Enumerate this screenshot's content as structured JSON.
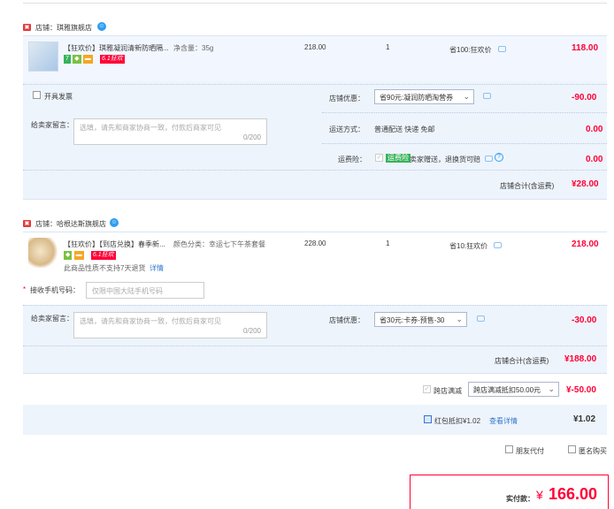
{
  "shop1": {
    "name": "店铺：琪雅旗舰店",
    "product_title": "【狂欢价】琪雅凝润清新防晒隔...",
    "product_spec": "净含量：35g",
    "unit_price": "218.00",
    "quantity": "1",
    "promo_saving": "省100:狂欢价",
    "subtotal": "118.00",
    "promo_tag": "6.1狂欢",
    "invoice_label": "开具发票",
    "shop_discount_label": "店铺优惠：",
    "shop_discount_value": "省90元:凝润防晒淘营券",
    "shop_discount_amount": "-90.00",
    "message_label": "给卖家留言：",
    "message_placeholder": "选填，请先和商家协商一致，付款后商家可见",
    "message_count": "0/200",
    "shipping_label": "运送方式：",
    "shipping_value": "普通配送 快递 免邮",
    "shipping_amount": "0.00",
    "insurance_label": "运费险：",
    "insurance_tag": "运费险",
    "insurance_value": "卖家赠送，退换货可赔",
    "insurance_amount": "0.00",
    "total_label": "店铺合计(含运费)",
    "total_value": "¥28.00"
  },
  "shop2": {
    "name": "店铺：哈根达斯旗舰店",
    "product_title": "【狂欢价】【到店兑换】春季新...",
    "product_spec": "颜色分类：幸运七下午茶套餐",
    "unit_price": "228.00",
    "quantity": "1",
    "promo_saving": "省10:狂欢价",
    "subtotal": "218.00",
    "promo_tag": "6.1狂欢",
    "no_return_note": "此商品性质不支持7天退货",
    "details_link": "详情",
    "phone_label": "接收手机号码：",
    "phone_placeholder": "仅限中国大陆手机号码",
    "message_label": "给卖家留言：",
    "message_placeholder": "选填，请先和商家协商一致，付款后商家可见",
    "message_count": "0/200",
    "shop_discount_label": "店铺优惠：",
    "shop_discount_value": "省30元:卡券-预售-30",
    "shop_discount_amount": "-30.00",
    "total_label": "店铺合计(含运费)",
    "total_value": "¥188.00"
  },
  "cross_store": {
    "label": "跨店满减",
    "select_value": "跨店满减抵扣50.00元",
    "amount": "¥-50.00"
  },
  "red_packet": {
    "label": "红包抵扣¥1.02",
    "link": "查看详情",
    "amount": "¥1.02"
  },
  "options": {
    "friend_pay": "朋友代付",
    "anonymous": "匿名购买"
  },
  "payment": {
    "label": "实付款：",
    "currency": "¥",
    "amount": "166.00"
  },
  "colors": {
    "accent_red": "#ff0036",
    "panel_blue": "#f2f7ff",
    "border_blue": "#b8c9e0"
  }
}
